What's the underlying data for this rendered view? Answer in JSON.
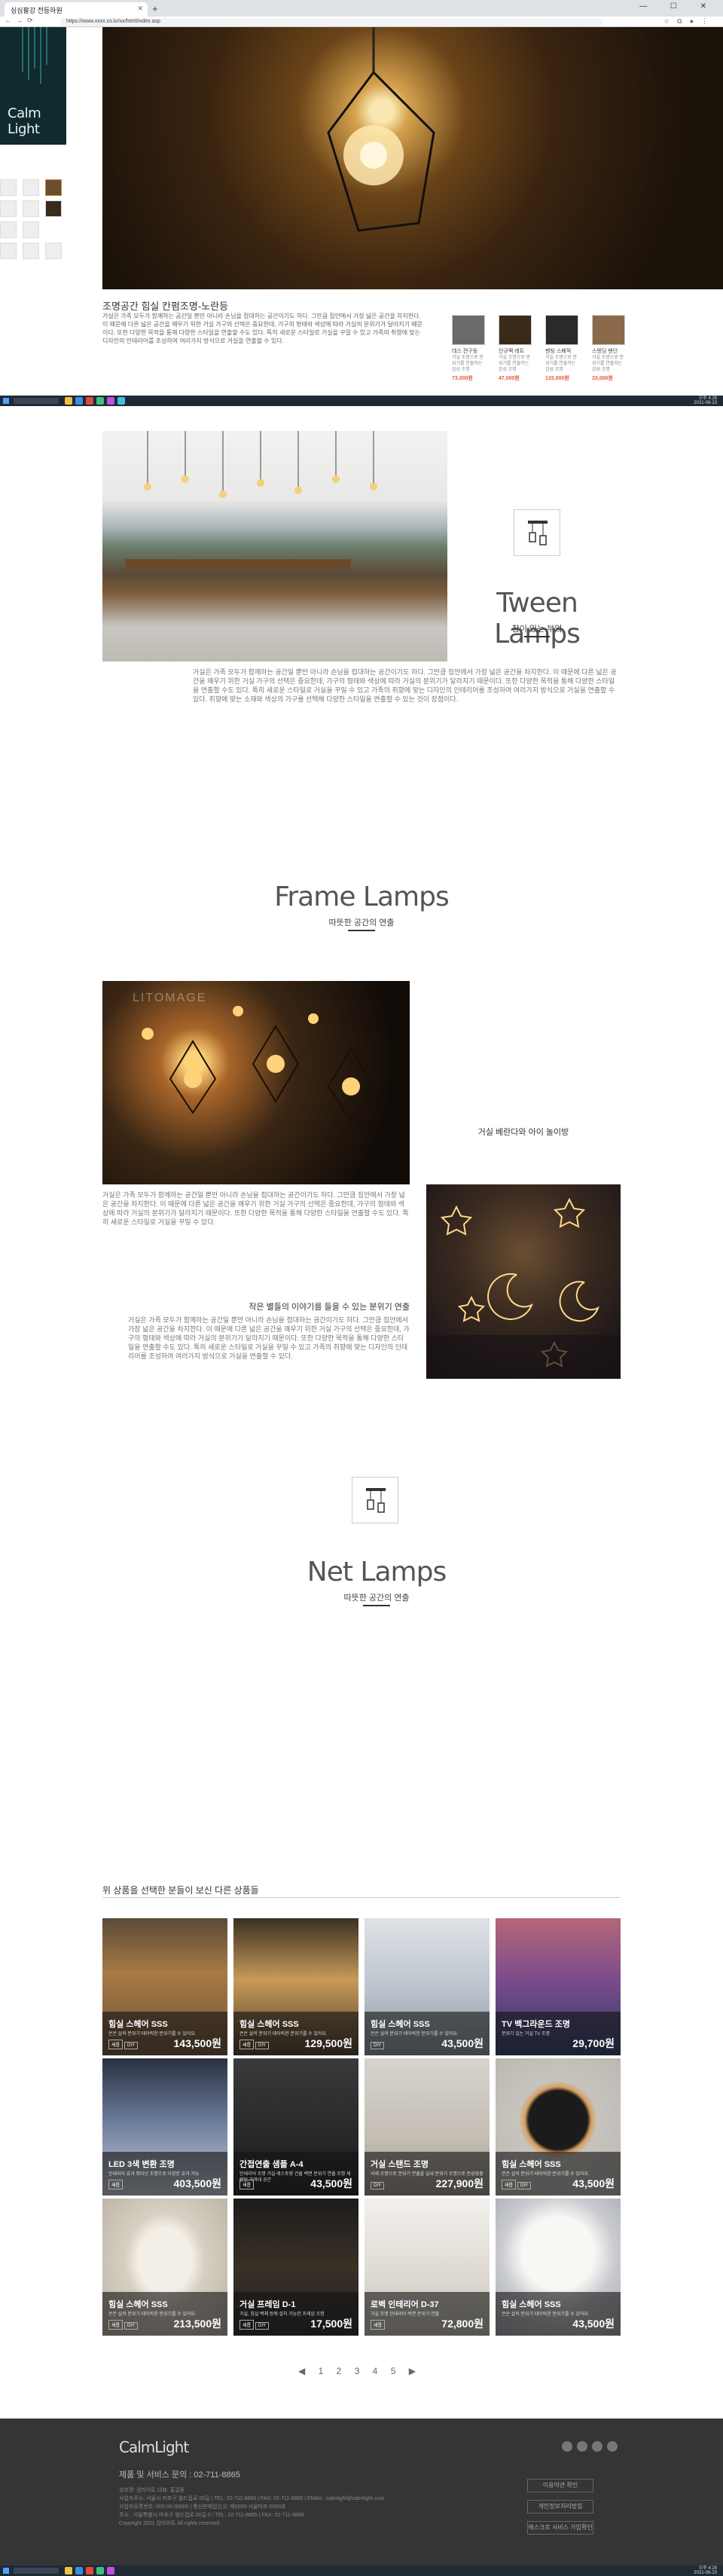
{
  "browser": {
    "tab_title": "심심팔강 전등하원",
    "url": "https://www.xxxx.co.kr/xx/html/index.asp",
    "window_controls": "— ☐ ✕"
  },
  "taskbar": {
    "time": "오후 4:28",
    "date": "2021-06-23"
  },
  "product_top": {
    "logo": "Calm Light",
    "title": "조명공간 힘실 칸펌조명-노란등",
    "description": "거실은 가족 모두가 함께하는 공간일 뿐만 아니라 손님을 접대하는 공간이기도 하다. 그만큼 집안에서 가장 넓은 공간을 차지한다. 이 때문에 다른 넓은 공간을 꽤우기 위한 거실 가구의 선택은 중요한데, 가구의 형태와 색상에 따라 거실의 분위기가 달라지기 때문이다. 또한 다양한 목적을 통해 다양한 스타일을 연출할 수도 있다. 특히 새로운 스타일로 거실을 꾸밀 수 있고 가족의 취향에 맞는 디자인의 인테리어를 조성하여 여러가지 방식으로 거실을 연출할 수 있다.",
    "related": [
      {
        "name": "데스 전구등",
        "desc": "거실 조명으로 분위기를 연출하는 감성 조명",
        "price": "73,000원"
      },
      {
        "name": "인규팩 레트",
        "desc": "거실 조명으로 분위기를 연출하는 감성 조명",
        "price": "47,000원"
      },
      {
        "name": "펜팅 스폐적",
        "desc": "거실 조명으로 분위기를 연출하는 감성 조명",
        "price": "133,000원"
      },
      {
        "name": "스텐딩 팬던",
        "desc": "거실 조명으로 분위기를 연출하는 감성 조명",
        "price": "33,000원"
      }
    ]
  },
  "tween": {
    "title": "Tween Lamps",
    "subtitle": "참이 있는 부엌",
    "description": "거실은 가족 모두가 함께하는 공간일 뿐만 아니라 손님을 접대하는 공간이기도 하다. 그만큼 집안에서 가장 넓은 공간을 차지한다. 이 때문에 다른 넓은 공간을 꽤우기 위한 거실 가구의 선택은 중요한데, 가구의 형태와 색상에 따라 거실의 분위기가 달라지기 때문이다. 또한 다양한 목적을 통해 다양한 스타일을 연출할 수도 있다. 특히 새로운 스타일로 거실을 꾸밀 수 있고 가족의 취향에 맞는 디자인의 인테리어를 조성하여 여러가지 방식으로 거실을 연출할 수 있다. 취향에 맞는 소재와 색상의 가구를 선택해 다양한 스타일을 연출할 수 있는 것이 장점이다."
  },
  "frame": {
    "title": "Frame Lamps",
    "subtitle": "따뜻한 공간의 연출",
    "watermark": "LITOMAGE",
    "caption1": "거실 베란다와 아이 놀이방",
    "paragraph1": "거실은 가족 모두가 함께하는 공간일 뿐만 아니라 손님을 접대하는 공간이기도 하다. 그만큼 집안에서 가장 넓은 공간을 차지한다. 이 때문에 다른 넓은 공간을 꽤우기 위한 거실 가구의 선택은 중요한데, 가구의 형태와 색상에 따라 거실의 분위기가 달라지기 때문이다. 또한 다양한 목적을 통해 다양한 스타일을 연출할 수도 있다. 특히 새로운 스타일로 거실을 꾸밀 수 있다.",
    "caption2": "작은 별들의 이야기를 들을 수 있는 분위기 연출",
    "paragraph2": "거실은 가족 모두가 함께하는 공간일 뿐만 아니라 손님을 접대하는 공간이기도 하다. 그만큼 집안에서 가장 넓은 공간을 차지한다. 이 때문에 다른 넓은 공간을 꽤우기 위한 거실 가구의 선택은 중요한데, 가구의 형태와 색상에 따라 거실의 분위기가 달라지기 때문이다. 또한 다양한 목적을 통해 다양한 스타일을 연출할 수도 있다. 특히 새로운 스타일로 거실을 꾸밀 수 있고 가족의 취향에 맞는 디자인의 인테리어를 조성하여 여러가지 방식으로 거실을 연출할 수 있다."
  },
  "net": {
    "title": "Net Lamps",
    "subtitle": "따뜻한 공간의 연출"
  },
  "products": {
    "heading": "위 상품을 선택한 분들이 보신 다른 상품들",
    "items": [
      {
        "name": "힘실 스헤어 SSS",
        "desc": "은은 살의 분위기 테이릭한 분위기를 수 있어요.",
        "tags": [
          "새롭",
          "DIY"
        ],
        "price": "143,500원",
        "bg": "linear-gradient(180deg,#5a4a3a 0%,#a87a44 40%,#6b5038 100%)"
      },
      {
        "name": "힘실 스헤어 SSS",
        "desc": "은은 살의 분위기 테이릭한 분위기를 수 있어요.",
        "tags": [
          "새롭",
          "DIY"
        ],
        "price": "129,500원",
        "bg": "linear-gradient(180deg,#3a3024 0%,#c89a58 45%,#4a3a28 100%)"
      },
      {
        "name": "힘실 스헤어 SSS",
        "desc": "은은 살의 분위기 테이릭한 분위기를 수 있어요.",
        "tags": [
          "DIY"
        ],
        "price": "43,500원",
        "bg": "linear-gradient(180deg,#dfe2e6 0%,#b9c2cb 55%,#8a939c 100%)"
      },
      {
        "name": "TV 백그라운드 조명",
        "desc": "분위기 있는 거실 TV 조명",
        "tags": [],
        "price": "29,700원",
        "bg": "linear-gradient(180deg,#b6667a 0%,#7a4c8a 45%,#2a3a6a 100%)"
      },
      {
        "name": "LED 3색 변환 조명",
        "desc": "인테리어 효과 뛰어난 조명으로 다양한 효과 가능",
        "tags": [
          "새롭"
        ],
        "price": "403,500원",
        "bg": "linear-gradient(180deg,#2a3040 0%,#6a7a9a 45%,#c8cfd8 100%)"
      },
      {
        "name": "간접연출 샘플 A-4",
        "desc": "인테리어 조명 거실 레스토랑 건물 벽면 분위기 연출 조명 세련된 가격대 공간",
        "tags": [
          "새롭"
        ],
        "price": "43,500원",
        "bg": "linear-gradient(180deg,#3a3a3a 0%,#2a2a2a 50%,#1a1a1a 100%)"
      },
      {
        "name": "거실 스탠드 조명",
        "desc": "서재 조명으로 분위기 연출을 실내 분위기 조명으로 안성맞춤",
        "tags": [
          "DIY"
        ],
        "price": "227,900원",
        "bg": "linear-gradient(180deg,#d8d4ce 0%,#c2bcb2 60%,#9c958a 100%)"
      },
      {
        "name": "힘실 스헤어 SSS",
        "desc": "은은 살의 분위기 테이릭한 분위기를 수 있어요.",
        "tags": [
          "새롭",
          "DIY"
        ],
        "price": "43,500원",
        "bg": "radial-gradient(circle at 50% 45%,#1b1b1b 0 30%,#d8a060 34%,#c7c3bd 40%,#b9b5af 100%)"
      },
      {
        "name": "힘실 스헤어 SSS",
        "desc": "은은 살의 분위기 테이릭한 분위기를 수 있어요.",
        "tags": [
          "새롭",
          "DIY"
        ],
        "price": "213,500원",
        "bg": "radial-gradient(ellipse at 50% 45%,#f4efe6 0 30%,#d7cfc2 45%,#b9b0a2 100%)"
      },
      {
        "name": "거실 프레임 D-1",
        "desc": "거실, 침실 벽체 등에 설치 가능한 프레임 조명",
        "tags": [
          "새롭",
          "DIY"
        ],
        "price": "17,500원",
        "bg": "linear-gradient(180deg,#1c1c1c 0%,#3a3026 50%,#222 100%)"
      },
      {
        "name": "로벽 인테리어 D-37",
        "desc": "거실 조명 인테리어 벽면 분위기 연출",
        "tags": [
          "새롭"
        ],
        "price": "72,800원",
        "bg": "linear-gradient(180deg,#f2f0ed 0%,#ddd8d0 60%,#c7c1b8 100%)"
      },
      {
        "name": "힘실 스헤어 SSS",
        "desc": "은은 살의 분위기 테이릭한 분위기를 수 있어요.",
        "tags": [],
        "price": "43,500원",
        "bg": "radial-gradient(circle at 50% 40%,#f7f7f4 0 35%,#c9cbd0 55%,#9ea2a8 100%)"
      }
    ],
    "pagination": [
      "◀",
      "1",
      "2",
      "3",
      "4",
      "5",
      "▶"
    ]
  },
  "footer": {
    "logo": "CalmLight",
    "cs": "제품 및 서비스 문의 : 02-711-8865",
    "info": "상호명: 캄라이트  대표: 홍길동\n사업자주소: 서울시 마포구 월드컵로 00길  |  TEL: 02-711-8865  |  FAX: 02-711-8866  |  EMAIL: calmlight@calmlight.com\n사업자등록번호: 000-00-00000  |  통신판매업신고: 제0000-서울마포-0000호\n주소 : 서울특별시 마포구 월드컵로 00길 0 / TEL: 02-711-8865  |  FAX: 02-711-8866\nCopyright 2021 캄라이트 All rights reserved.",
    "buttons": [
      "이용약관 확인",
      "개인정보처리방침",
      "에스크로 서비스 가입확인"
    ]
  }
}
